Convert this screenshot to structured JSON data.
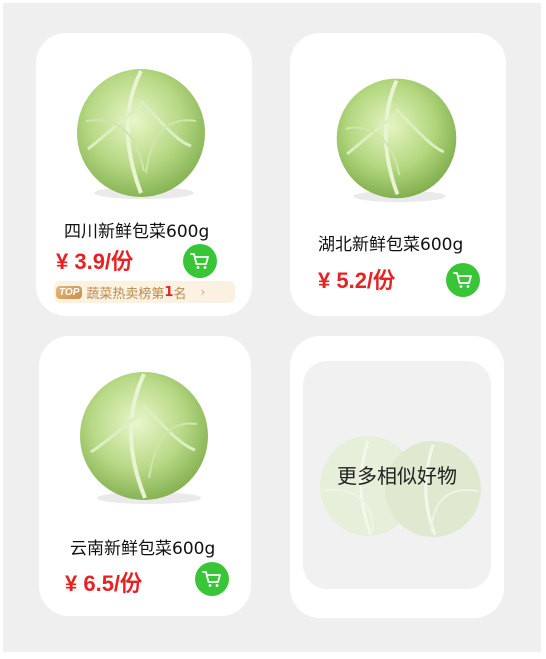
{
  "products": [
    {
      "name": "四川新鲜包菜600g",
      "price": "¥ 3.9/份",
      "rank_tag": {
        "badge": "TOP",
        "text_before": "蔬菜热卖榜第",
        "rank": "1",
        "text_after": "名",
        "chevron": "›"
      }
    },
    {
      "name": "湖北新鲜包菜600g",
      "price": "¥ 5.2/份"
    },
    {
      "name": "云南新鲜包菜600g",
      "price": "¥ 6.5/份"
    }
  ],
  "more_similar": {
    "label": "更多相似好物"
  },
  "icons": {
    "cart": "shopping-cart-icon",
    "product_image": "cabbage-image"
  },
  "colors": {
    "price": "#e62222",
    "cart_button": "#38c538",
    "background": "#efefef",
    "card": "#ffffff"
  }
}
